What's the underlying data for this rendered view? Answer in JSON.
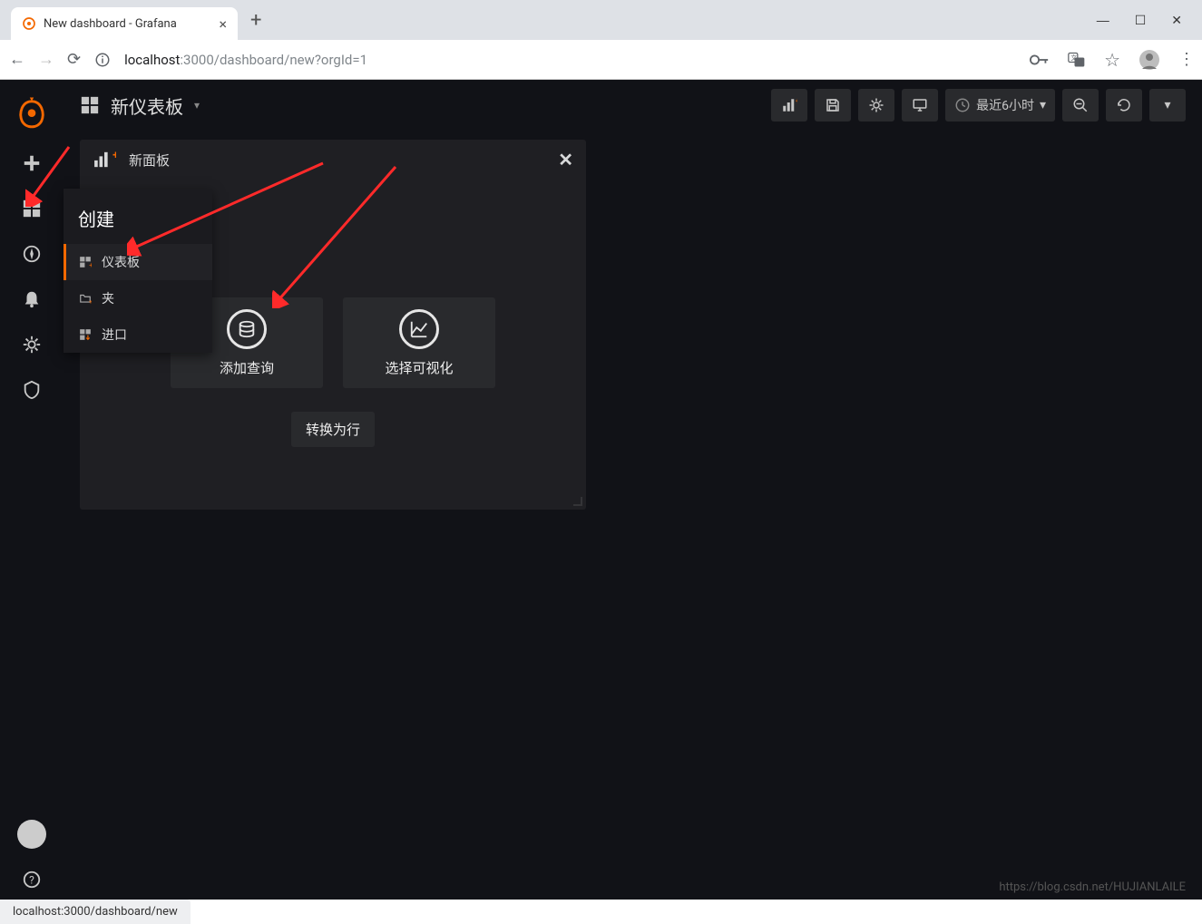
{
  "browser": {
    "tab_title": "New dashboard - Grafana",
    "url_host": "localhost",
    "url_port_path": ":3000/dashboard/new?orgId=1",
    "hover_url": "localhost:3000/dashboard/new"
  },
  "topbar": {
    "dashboard_title": "新仪表板",
    "time_range": "最近6小时"
  },
  "panel": {
    "title": "新面板",
    "add_query": "添加查询",
    "choose_viz": "选择可视化",
    "convert_row": "转换为行"
  },
  "flyout": {
    "title": "创建",
    "items": [
      {
        "label": "仪表板",
        "icon": "dashboard"
      },
      {
        "label": "夹",
        "icon": "folder"
      },
      {
        "label": "进口",
        "icon": "import"
      }
    ]
  },
  "watermark": "https://blog.csdn.net/HUJIANLAILE"
}
